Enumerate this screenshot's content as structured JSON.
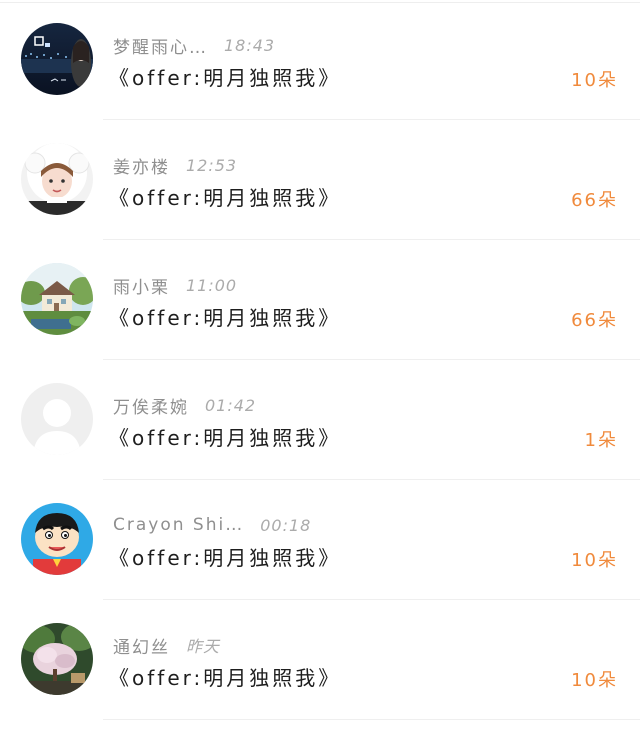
{
  "colors": {
    "gift_accent": "#f08a3c",
    "name_text": "#8f8f8f",
    "time_text": "#ababab",
    "message_text": "#1e1e1e"
  },
  "items": [
    {
      "name": "梦醒雨心…",
      "time": "18:43",
      "message": "《offer:明月独照我》",
      "gift": "10朵",
      "avatar": "night-city-photo"
    },
    {
      "name": "姜亦楼",
      "time": "12:53",
      "message": "《offer:明月独照我》",
      "gift": "66朵",
      "avatar": "girl-white-hood-photo"
    },
    {
      "name": "雨小栗",
      "time": "11:00",
      "message": "《offer:明月独照我》",
      "gift": "66朵",
      "avatar": "anime-house-illustration"
    },
    {
      "name": "万俟柔婉",
      "time": "01:42",
      "message": "《offer:明月独照我》",
      "gift": "1朵",
      "avatar": "default-user-silhouette"
    },
    {
      "name": "Crayon Shi…",
      "time": "00:18",
      "message": "《offer:明月独照我》",
      "gift": "10朵",
      "avatar": "cartoon-boy-face"
    },
    {
      "name": "通幻丝",
      "time": "昨天",
      "message": "《offer:明月独照我》",
      "gift": "10朵",
      "avatar": "blossom-tree-photo"
    }
  ]
}
